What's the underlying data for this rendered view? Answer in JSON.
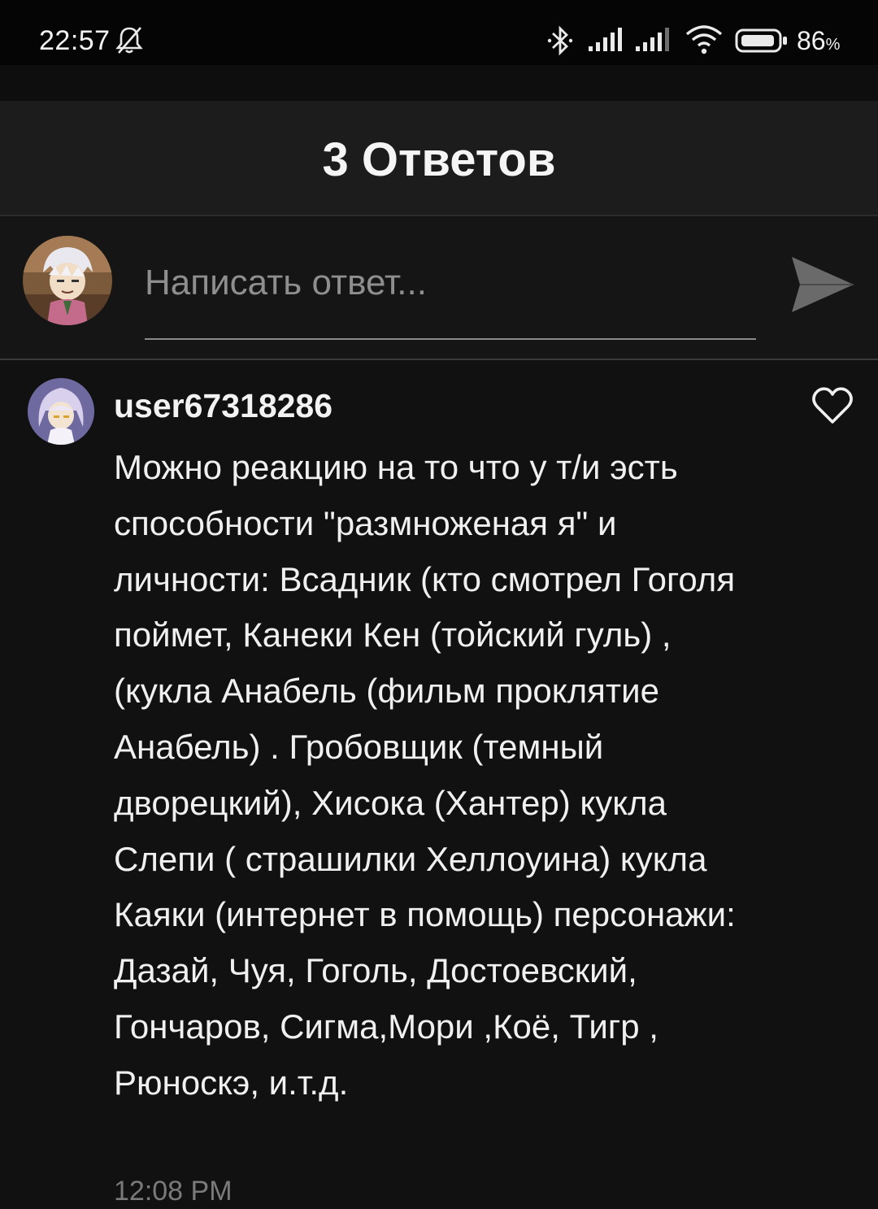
{
  "status_bar": {
    "time": "22:57",
    "battery_percent": "86",
    "battery_unit": "%",
    "icons": [
      "mute-bell-icon",
      "bluetooth-icon",
      "signal-icon",
      "signal-icon",
      "wifi-icon",
      "battery-icon"
    ]
  },
  "header": {
    "title": "3 Ответов"
  },
  "reply_box": {
    "placeholder": "Написать ответ...",
    "send_icon": "send-icon"
  },
  "comments": [
    {
      "username": "user67318286",
      "text": "Можно реакцию на то что у т/и эсть способности \"размноженая я\" и личности: Всадник (кто смотрел Гоголя поймет, Канеки Кен (тойский гуль) , (кукла Анабель (фильм проклятие Анабель) . Гробовщик (темный дворецкий), Хисока (Хантер) кукла Слепи ( страшилки Хеллоуина) кукла Каяки (интернет в помощь) персонажи: Дазай, Чуя, Гоголь, Достоевский, Гончаров, Сигма,Мори ,Коё, Тигр , Рюноскэ, и.т.д.",
      "time": "12:08 PM",
      "like_icon": "heart-outline-icon"
    }
  ],
  "colors": {
    "background": "#111111",
    "header_background": "#1c1c1c",
    "text": "#f0f0f0",
    "muted_text": "#8e8e8e"
  }
}
